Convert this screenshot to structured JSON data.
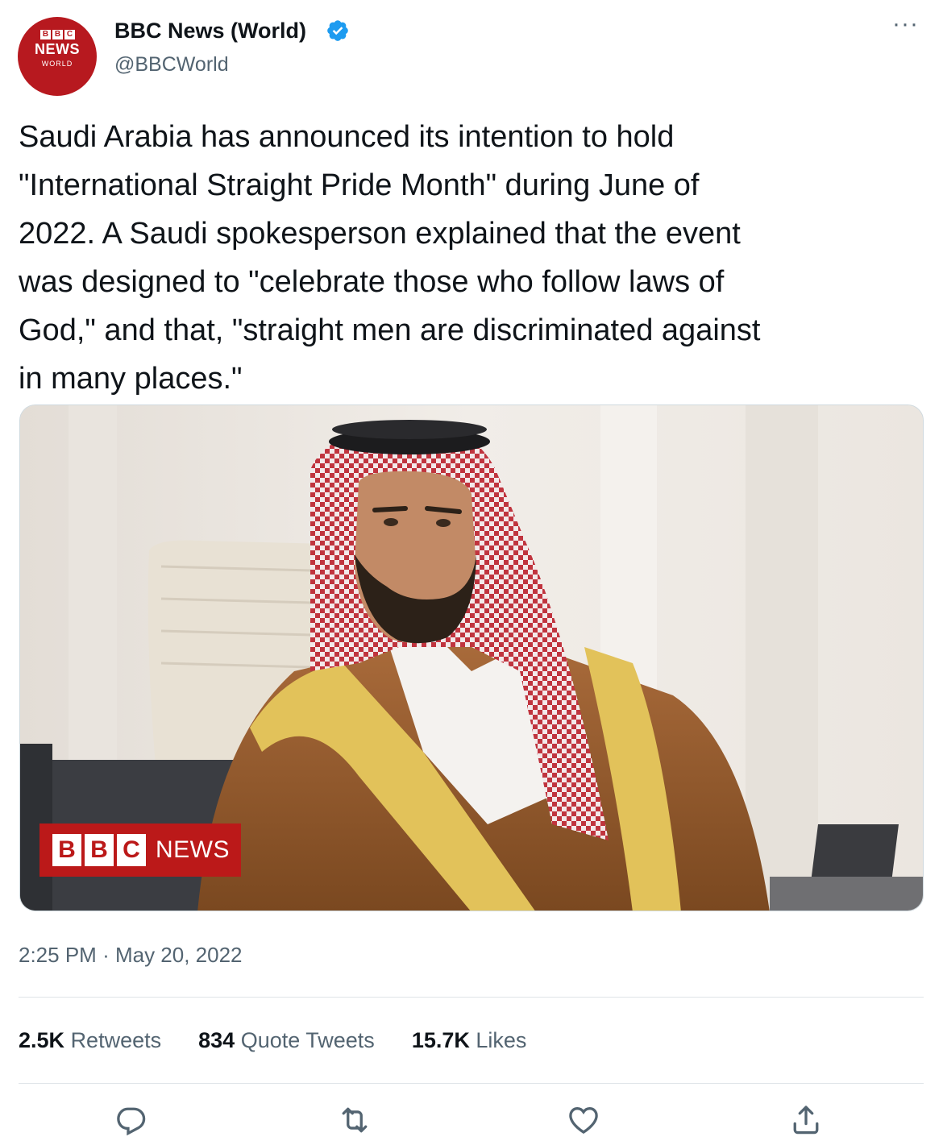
{
  "author": {
    "avatar": {
      "bbc_letters": [
        "B",
        "B",
        "C"
      ],
      "line1": "NEWS",
      "line2": "WORLD"
    },
    "display_name": "BBC News (World)",
    "handle": "@BBCWorld",
    "verified_icon": "verified-badge-icon",
    "verified_color": "#1d9bf0"
  },
  "more_icon": "more-options-icon",
  "tweet": {
    "text": "Saudi Arabia has announced its intention to hold\n\"International Straight Pride Month\" during June of\n2022. A Saudi spokesperson explained that the event\nwas designed to \"celebrate those who follow laws of\nGod,\" and that, \"straight men are discriminated against\nin many places.\""
  },
  "media": {
    "badge_letters": [
      "B",
      "B",
      "C"
    ],
    "badge_text": "NEWS",
    "badge_color": "#bb1919"
  },
  "meta": {
    "time": "2:25 PM",
    "separator": "·",
    "date": "May 20, 2022"
  },
  "stats": {
    "retweets_count": "2.5K",
    "retweets_label": "Retweets",
    "quotes_count": "834",
    "quotes_label": "Quote Tweets",
    "likes_count": "15.7K",
    "likes_label": "Likes"
  },
  "actions": [
    "reply-icon",
    "retweet-icon",
    "like-icon",
    "share-icon"
  ],
  "colors": {
    "text": "#0f1419",
    "secondary": "#536471",
    "divider": "#dfe4e8"
  }
}
